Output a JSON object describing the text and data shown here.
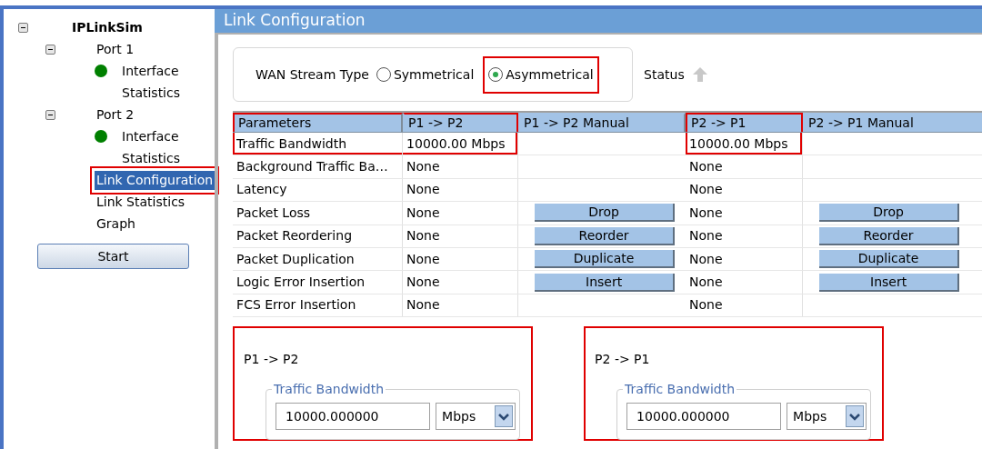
{
  "tree": {
    "label": "IPLinkSim",
    "expanded": true,
    "children": [
      {
        "label": "Port 1",
        "expanded": true,
        "children": [
          {
            "label": "Interface",
            "color": "#008000",
            "selected": false,
            "highlighted": false
          },
          {
            "label": "Statistics",
            "selected": false,
            "highlighted": false
          }
        ]
      },
      {
        "label": "Port 2",
        "expanded": true,
        "children": [
          {
            "label": "Interface",
            "color": "#008000",
            "selected": false,
            "highlighted": false
          },
          {
            "label": "Statistics",
            "selected": false,
            "highlighted": false
          }
        ]
      },
      {
        "label": "Link Configuration",
        "selected": true,
        "highlighted": true
      },
      {
        "label": "Link Statistics",
        "selected": false,
        "highlighted": false
      },
      {
        "label": "Graph",
        "selected": false,
        "highlighted": false
      }
    ]
  },
  "start_button": "Start",
  "panel_title": "Link Configuration",
  "stream_type": {
    "label": "WAN Stream Type",
    "options": [
      {
        "label": "Symmetrical",
        "selected": false,
        "highlighted": false
      },
      {
        "label": "Asymmetrical",
        "selected": true,
        "highlighted": true
      }
    ]
  },
  "status_label": "Status",
  "table": {
    "columns": [
      {
        "label": "Parameters",
        "highlighted": true
      },
      {
        "label": "P1 -> P2",
        "highlighted": true
      },
      {
        "label": "P1 -> P2 Manual",
        "highlighted": false
      },
      {
        "label": "P2 -> P1",
        "highlighted": true
      },
      {
        "label": "P2 -> P1 Manual",
        "highlighted": false
      }
    ],
    "rows": [
      {
        "highlighted": true,
        "cells": [
          "Traffic Bandwidth",
          "10000.00 Mbps",
          null,
          "10000.00 Mbps",
          null
        ]
      },
      {
        "highlighted": false,
        "cells": [
          "Background Traffic Ba…",
          "None",
          null,
          "None",
          null
        ]
      },
      {
        "highlighted": false,
        "cells": [
          "Latency",
          "None",
          null,
          "None",
          null
        ]
      },
      {
        "highlighted": false,
        "cells": [
          "Packet Loss",
          "None",
          {
            "button": "Drop"
          },
          "None",
          {
            "button": "Drop"
          }
        ]
      },
      {
        "highlighted": false,
        "cells": [
          "Packet Reordering",
          "None",
          {
            "button": "Reorder"
          },
          "None",
          {
            "button": "Reorder"
          }
        ]
      },
      {
        "highlighted": false,
        "cells": [
          "Packet Duplication",
          "None",
          {
            "button": "Duplicate"
          },
          "None",
          {
            "button": "Duplicate"
          }
        ]
      },
      {
        "highlighted": false,
        "cells": [
          "Logic Error Insertion",
          "None",
          {
            "button": "Insert"
          },
          "None",
          {
            "button": "Insert"
          }
        ]
      },
      {
        "highlighted": false,
        "cells": [
          "FCS Error Insertion",
          "None",
          null,
          "None",
          null
        ]
      }
    ]
  },
  "directions": [
    {
      "title": "P1 -> P2",
      "highlighted": true,
      "group_label": "Traffic Bandwidth",
      "value": "10000.000000",
      "unit": "Mbps"
    },
    {
      "title": "P2 -> P1",
      "highlighted": true,
      "group_label": "Traffic Bandwidth",
      "value": "10000.000000",
      "unit": "Mbps"
    }
  ]
}
